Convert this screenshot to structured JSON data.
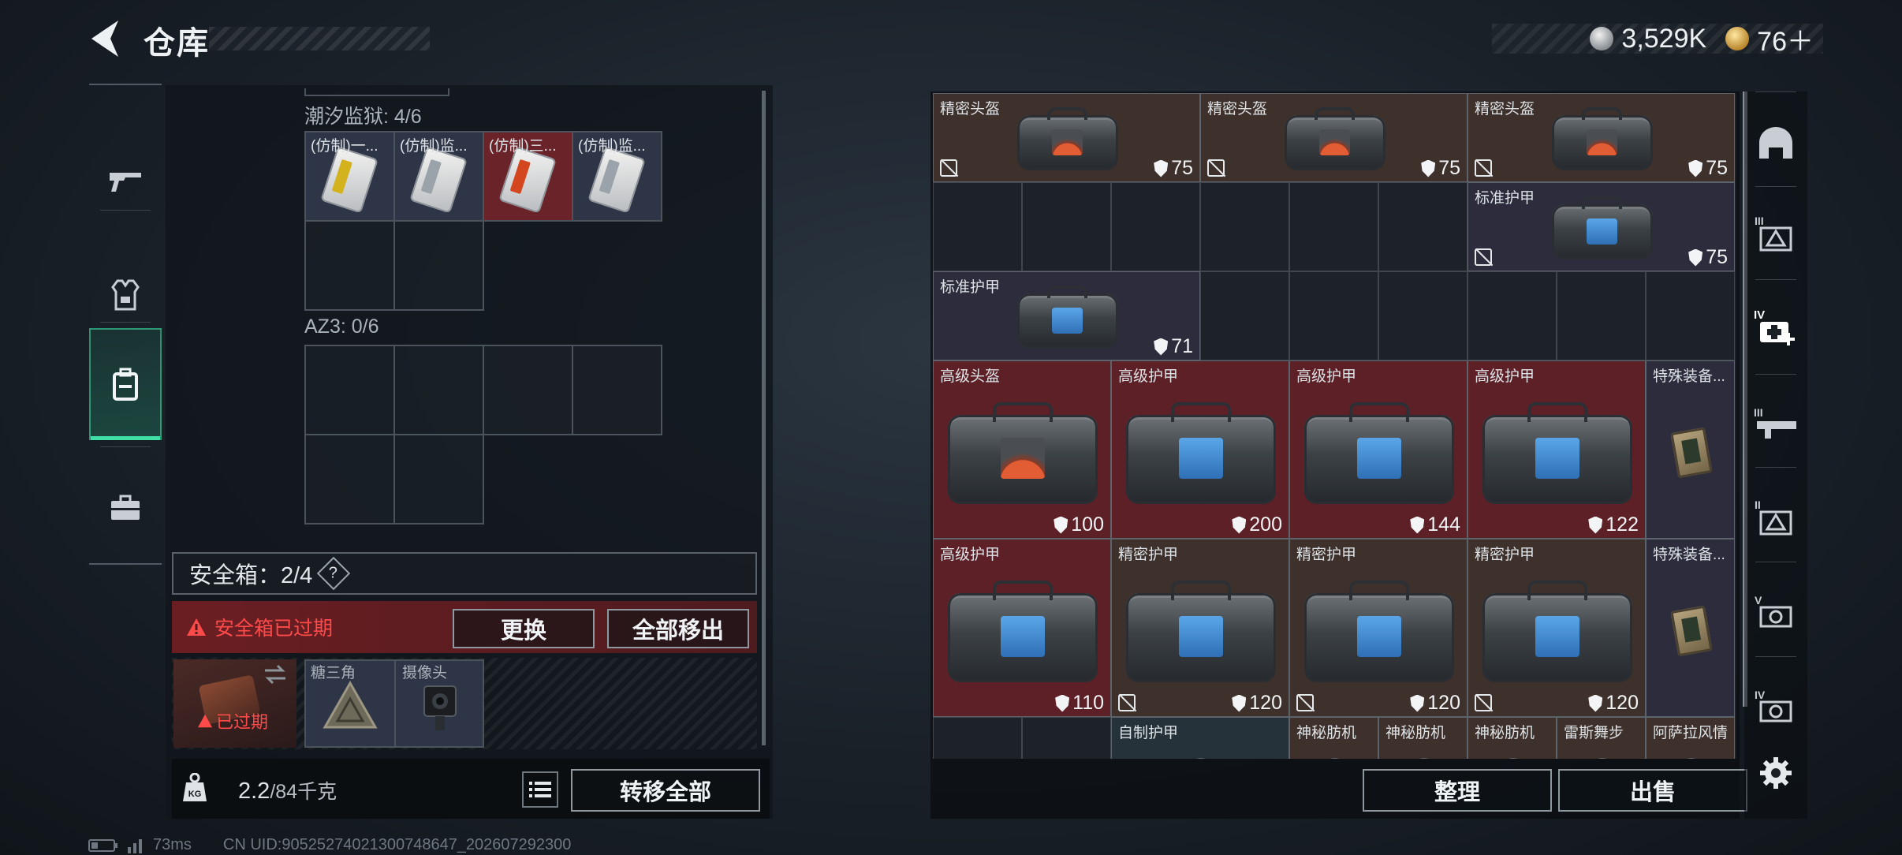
{
  "header": {
    "title": "仓库",
    "currency": [
      {
        "icon": "silver-coin-icon",
        "value": "3,529K"
      },
      {
        "icon": "gold-coin-icon",
        "value": "76＋"
      }
    ]
  },
  "left_tabs": [
    {
      "icon": "gun-icon",
      "active": false
    },
    {
      "icon": "armor-vest-icon",
      "active": false
    },
    {
      "icon": "backpack-icon",
      "active": true
    },
    {
      "icon": "briefcase-icon",
      "active": false
    }
  ],
  "containers": {
    "section1_label": "潮汐监狱: 4/6",
    "section1_items": [
      {
        "label": "(仿制)一...",
        "stripe": "#d4b21e",
        "tone": "blue"
      },
      {
        "label": "(仿制)监...",
        "stripe": "#9aa3aa",
        "tone": "blue"
      },
      {
        "label": "(仿制)三...",
        "stripe": "#d4461e",
        "tone": "red"
      },
      {
        "label": "(仿制)监...",
        "stripe": "#9aa3aa",
        "tone": "blue"
      }
    ],
    "section2_label": "AZ3: 0/6"
  },
  "safe_box": {
    "label": "安全箱：2/4",
    "help": "?",
    "expired_warning": "安全箱已过期",
    "replace_button": "更换",
    "move_all_out_button": "全部移出",
    "expired_badge": "已过期",
    "slot1_label": "糖三角",
    "slot2_label": "摄像头"
  },
  "bottom": {
    "weight_unit_icon": "KG",
    "weight_current": "2.2",
    "weight_suffix": "/84千克",
    "transfer_all_button": "转移全部"
  },
  "warehouse": {
    "items": [
      {
        "name": "精密头盔",
        "durability": "75",
        "tone": "brown",
        "patch": "orange",
        "nodrop": true
      },
      {
        "name": "精密头盔",
        "durability": "75",
        "tone": "brown",
        "patch": "orange",
        "nodrop": true
      },
      {
        "name": "精密头盔",
        "durability": "75",
        "tone": "brown",
        "patch": "orange",
        "nodrop": true
      },
      {
        "name": "标准护甲",
        "durability": "75",
        "tone": "purple",
        "patch": "blue",
        "nodrop": true
      },
      {
        "name": "标准护甲",
        "durability": "71",
        "tone": "purple",
        "patch": "blue",
        "nodrop": false
      },
      {
        "name": "高级头盔",
        "durability": "100",
        "tone": "red",
        "patch": "orange",
        "nodrop": false
      },
      {
        "name": "高级护甲",
        "durability": "200",
        "tone": "red",
        "patch": "blue",
        "nodrop": false
      },
      {
        "name": "高级护甲",
        "durability": "144",
        "tone": "red",
        "patch": "blue",
        "nodrop": false
      },
      {
        "name": "高级护甲",
        "durability": "122",
        "tone": "red",
        "patch": "blue",
        "nodrop": false
      },
      {
        "name": "特殊装备...",
        "durability": "",
        "tone": "purple",
        "patch": "tablet",
        "nodrop": false
      },
      {
        "name": "高级护甲",
        "durability": "110",
        "tone": "red",
        "patch": "blue",
        "nodrop": false
      },
      {
        "name": "精密护甲",
        "durability": "120",
        "tone": "brown",
        "patch": "blue",
        "nodrop": true
      },
      {
        "name": "精密护甲",
        "durability": "120",
        "tone": "brown",
        "patch": "blue",
        "nodrop": true
      },
      {
        "name": "精密护甲",
        "durability": "120",
        "tone": "brown",
        "patch": "blue",
        "nodrop": true
      },
      {
        "name": "特殊装备...",
        "durability": "",
        "tone": "purple",
        "patch": "tablet",
        "nodrop": false
      },
      {
        "name": "自制护甲",
        "durability": "",
        "tone": "teal",
        "patch": "none",
        "nodrop": false
      },
      {
        "name": "神秘肪机",
        "durability": "",
        "tone": "brown",
        "patch": "none",
        "nodrop": false
      },
      {
        "name": "神秘肪机",
        "durability": "",
        "tone": "brown",
        "patch": "none",
        "nodrop": false
      },
      {
        "name": "神秘肪机",
        "durability": "",
        "tone": "brown",
        "patch": "none",
        "nodrop": false
      },
      {
        "name": "雷斯舞步",
        "durability": "",
        "tone": "brown",
        "patch": "none",
        "nodrop": false
      },
      {
        "name": "阿萨拉风情",
        "durability": "",
        "tone": "brown",
        "patch": "none",
        "nodrop": false
      }
    ],
    "sort_button": "整理",
    "sell_button": "出售"
  },
  "right_tabs": [
    {
      "icon": "helmet-icon"
    },
    {
      "icon": "armor-tier-iii-icon"
    },
    {
      "icon": "medkit-tier-iv-icon"
    },
    {
      "icon": "weapon-tier-iii-icon"
    },
    {
      "icon": "armor-tier-ii-icon"
    },
    {
      "icon": "scope-tier-v-icon"
    },
    {
      "icon": "scope-tier-iv-icon"
    },
    {
      "icon": "settings-gear-icon"
    }
  ],
  "footer": {
    "ping": "73ms",
    "uid": "CN UID:905252740213007486​47_202607292300"
  }
}
